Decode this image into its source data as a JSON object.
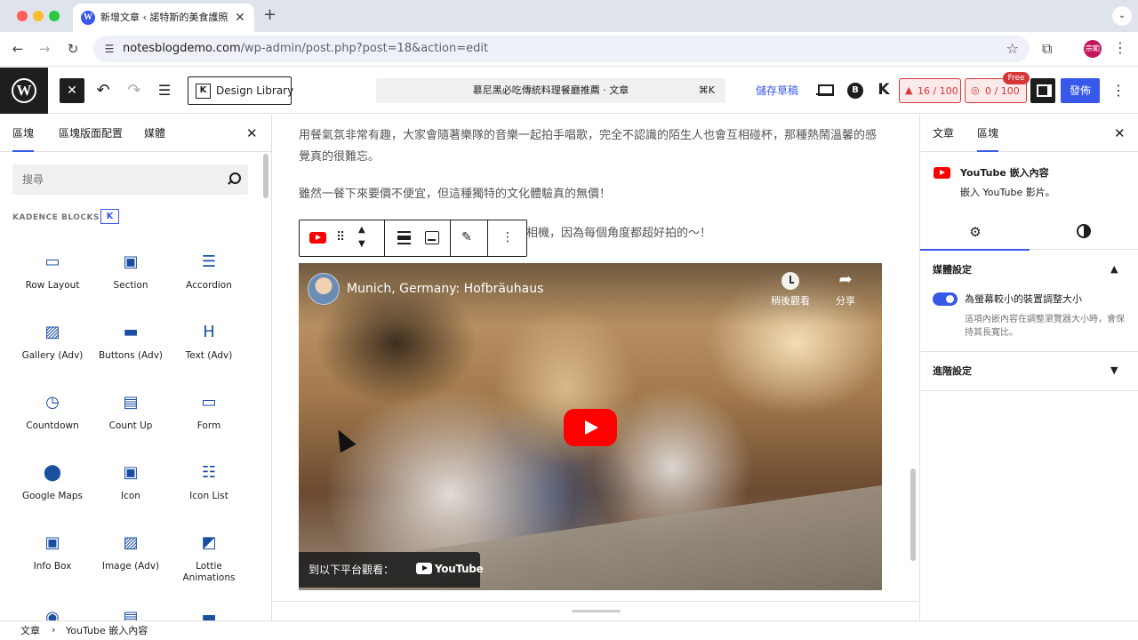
{
  "browser": {
    "tab_title": "新增文章 ‹ 諾特斯的美食護照 —",
    "url_host": "notesblogdemo.com",
    "url_path": "/wp-admin/post.php?post=18&action=edit",
    "profile_initials": "宗範"
  },
  "toolbar": {
    "design_library_label": "Design Library",
    "command_title": "慕尼黑必吃傳統料理餐廳推薦 · 文章",
    "command_shortcut": "⌘K",
    "save_draft_label": "儲存草稿",
    "seo_score": "16 / 100",
    "ai_score": "0 / 100",
    "free_tag": "Free",
    "publish_label": "發佈"
  },
  "inserter": {
    "tabs": [
      "區塊",
      "區塊版面配置",
      "媒體"
    ],
    "search_placeholder": "搜尋",
    "category_title": "KADENCE BLOCKS",
    "blocks": [
      {
        "label": "Row Layout",
        "icon": "row-layout-icon"
      },
      {
        "label": "Section",
        "icon": "section-icon"
      },
      {
        "label": "Accordion",
        "icon": "accordion-icon"
      },
      {
        "label": "Gallery (Adv)",
        "icon": "gallery-icon"
      },
      {
        "label": "Buttons (Adv)",
        "icon": "buttons-icon"
      },
      {
        "label": "Text (Adv)",
        "icon": "text-icon"
      },
      {
        "label": "Countdown",
        "icon": "countdown-icon"
      },
      {
        "label": "Count Up",
        "icon": "count-up-icon"
      },
      {
        "label": "Form",
        "icon": "form-icon"
      },
      {
        "label": "Google Maps",
        "icon": "map-pin-icon"
      },
      {
        "label": "Icon",
        "icon": "icon-block-icon"
      },
      {
        "label": "Icon List",
        "icon": "icon-list-icon"
      },
      {
        "label": "Info Box",
        "icon": "info-box-icon"
      },
      {
        "label": "Image (Adv)",
        "icon": "image-icon"
      },
      {
        "label": "Lottie Animations",
        "icon": "lottie-icon"
      }
    ]
  },
  "content": {
    "paragraph_1": "用餐氣氛非常有趣，大家會隨著樂隊的音樂一起拍手唱歌，完全不認識的陌生人也會互相碰杯，那種熱鬧溫馨的感覺真的很難忘。",
    "paragraph_2": "雖然一餐下來要價不便宜，但這種獨特的文化體驗真的無價！",
    "paragraph_3_visible": "相機，因為每個角度都超好拍的～！",
    "video": {
      "title": "Munich, Germany: Hofbräuhaus",
      "watch_later": "稍後觀看",
      "share": "分享",
      "watch_on": "到以下平台觀看：",
      "youtube_word": "YouTube"
    }
  },
  "sidebar": {
    "tabs": [
      "文章",
      "區塊"
    ],
    "block_title": "YouTube 嵌入內容",
    "block_desc": "嵌入 YouTube 影片。",
    "media_panel_title": "媒體設定",
    "toggle_label": "為螢幕較小的裝置調整大小",
    "toggle_checked": true,
    "toggle_help": "這項內嵌內容在調整瀏覽器大小時，會保持其長寬比。",
    "advanced_panel_title": "進階設定"
  },
  "breadcrumb": [
    "文章",
    "YouTube 嵌入內容"
  ],
  "colors": {
    "accent": "#3858e9",
    "youtube_red": "#ff0000",
    "seo_badge": "#d63638"
  }
}
